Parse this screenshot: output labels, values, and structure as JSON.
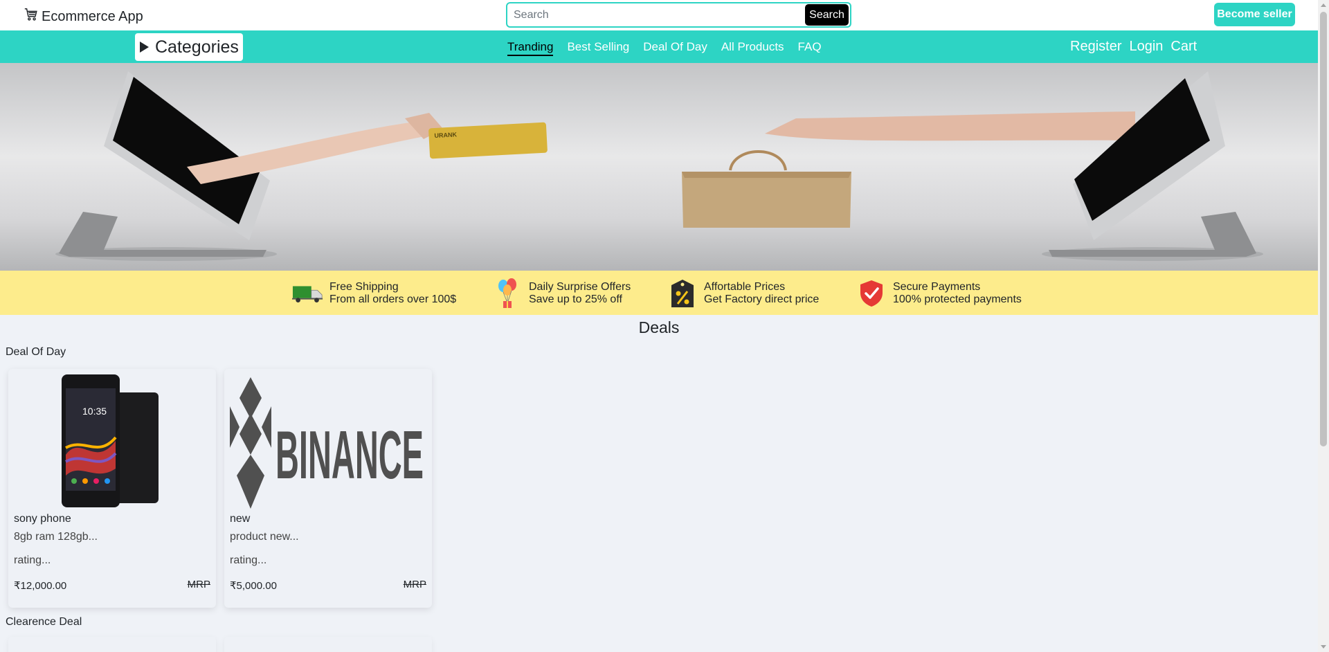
{
  "header": {
    "brand": "Ecommerce App",
    "brand_icon": "cart-icon",
    "search_placeholder": "Search",
    "search_value": "",
    "search_button": "Search",
    "seller_button": "Become seller"
  },
  "nav": {
    "categories_label": "Categories",
    "links": [
      "Tranding",
      "Best Selling",
      "Deal Of Day",
      "All Products",
      "FAQ"
    ],
    "active_link": "Tranding",
    "right_links": [
      "Register",
      "Login",
      "Cart"
    ]
  },
  "features": [
    {
      "icon": "truck-icon",
      "title": "Free Shipping",
      "subtitle": "From all orders over 100$"
    },
    {
      "icon": "balloons-gift-icon",
      "title": "Daily Surprise Offers",
      "subtitle": "Save up to 25% off"
    },
    {
      "icon": "percent-tag-icon",
      "title": "Affortable Prices",
      "subtitle": "Get Factory direct price"
    },
    {
      "icon": "shield-check-icon",
      "title": "Secure Payments",
      "subtitle": "100% protected payments"
    }
  ],
  "deals": {
    "title": "Deals",
    "sections": [
      "Deal Of Day",
      "Clearence Deal"
    ],
    "products": [
      {
        "name": "sony phone",
        "description": "8gb ram 128gb...",
        "rating": "rating...",
        "price": "₹12,000.00",
        "mrp": "MRP",
        "image": "phone-image"
      },
      {
        "name": "new",
        "description": "product new...",
        "rating": "rating...",
        "price": "₹5,000.00",
        "mrp": "MRP",
        "image": "binance-logo-image",
        "image_text": "BINANCE"
      }
    ]
  },
  "banner_card_text": "URANK",
  "colors": {
    "accent": "#2dd4c4",
    "features_bg": "#fdec8c",
    "page_bg": "#eff2f7"
  }
}
